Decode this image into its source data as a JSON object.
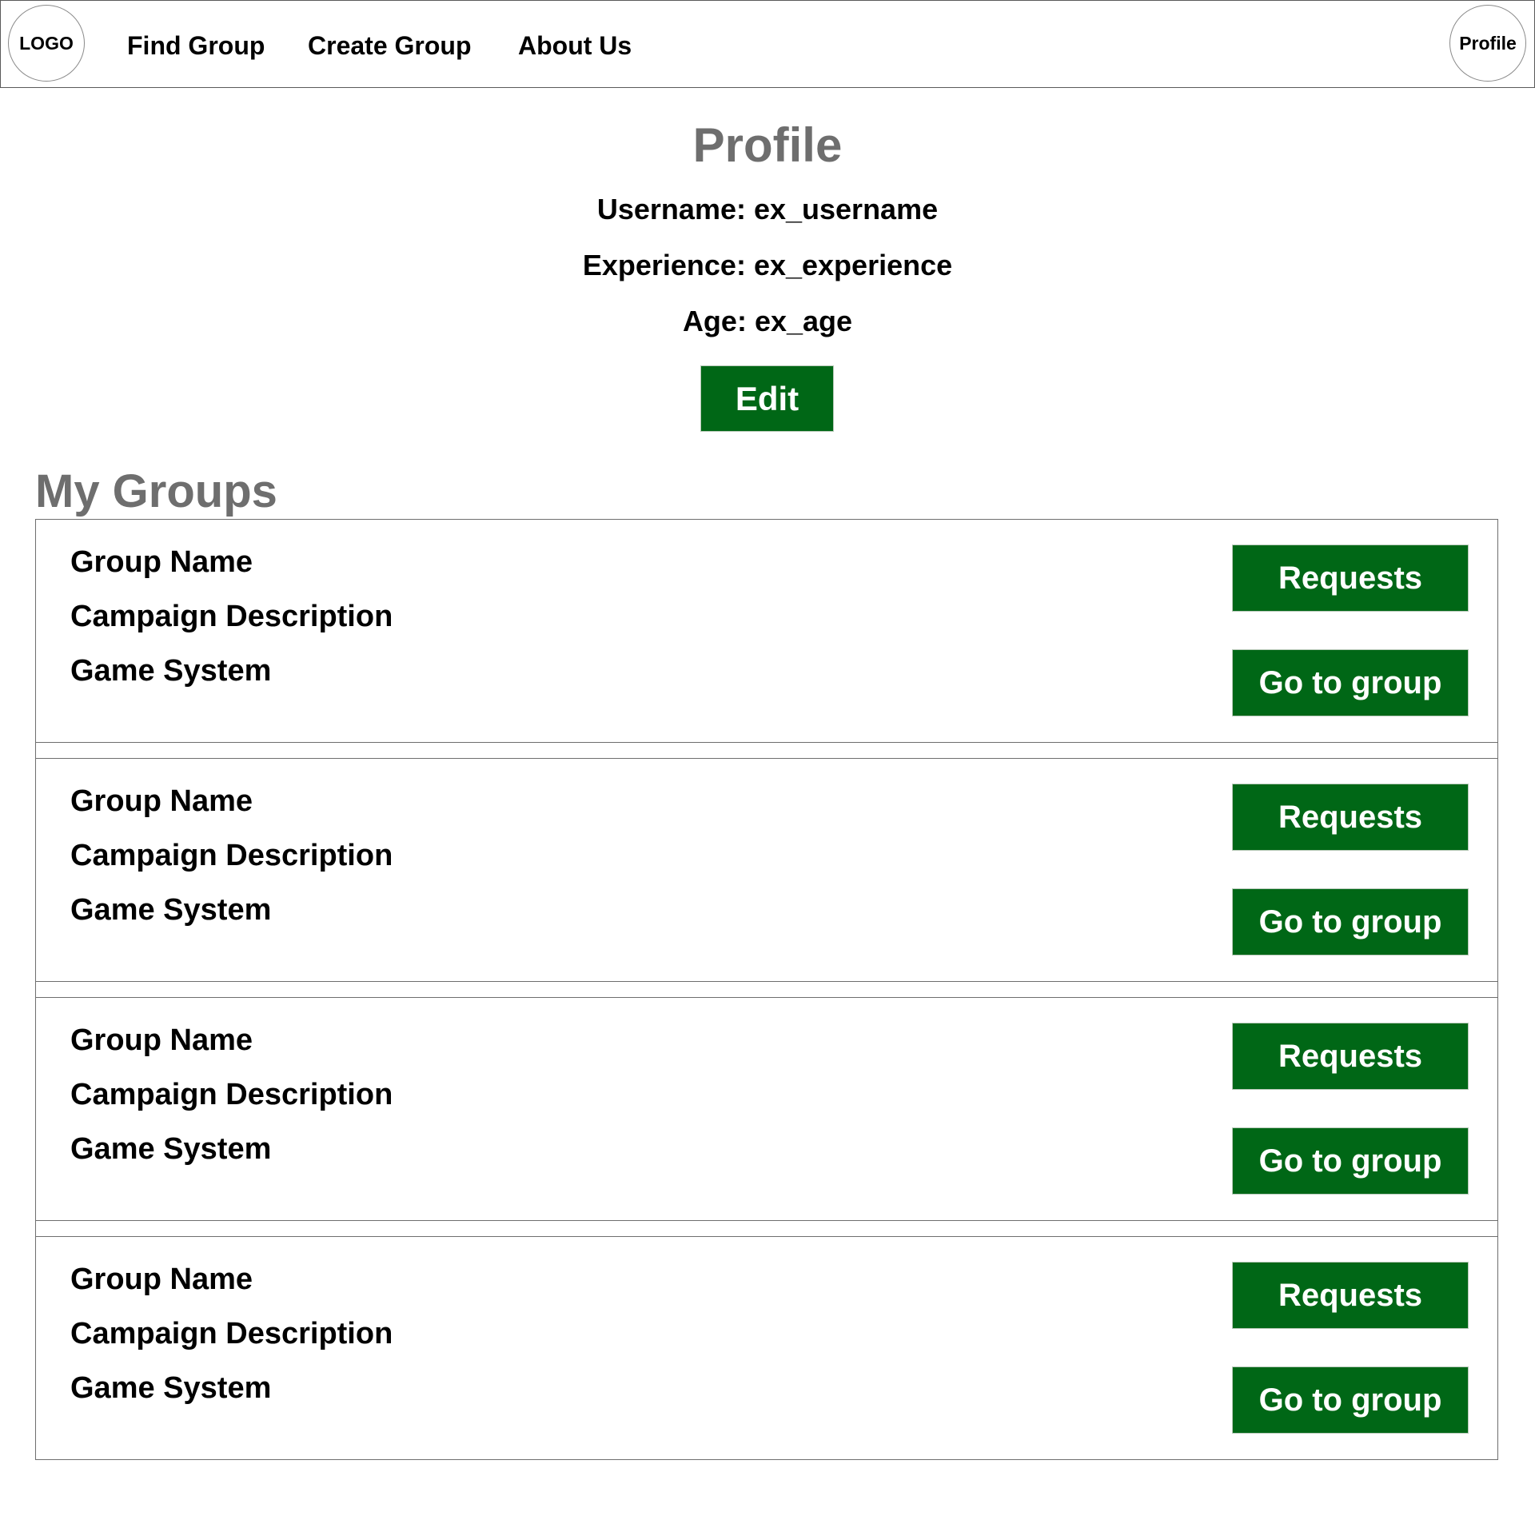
{
  "nav": {
    "logo_label": "LOGO",
    "links": [
      "Find Group",
      "Create Group",
      "About Us"
    ],
    "profile_label": "Profile"
  },
  "profile": {
    "title": "Profile",
    "username": "Username: ex_username",
    "experience": "Experience: ex_experience",
    "age": "Age: ex_age",
    "edit_label": "Edit"
  },
  "groups": {
    "title": "My Groups",
    "items": [
      {
        "name": "Group Name",
        "description": "Campaign Description",
        "system": "Game System",
        "requests_label": "Requests",
        "goto_label": "Go to group"
      },
      {
        "name": "Group Name",
        "description": "Campaign Description",
        "system": "Game System",
        "requests_label": "Requests",
        "goto_label": "Go to group"
      },
      {
        "name": "Group Name",
        "description": "Campaign Description",
        "system": "Game System",
        "requests_label": "Requests",
        "goto_label": "Go to group"
      },
      {
        "name": "Group Name",
        "description": "Campaign Description",
        "system": "Game System",
        "requests_label": "Requests",
        "goto_label": "Go to group"
      }
    ]
  },
  "colors": {
    "button_green": "#006716",
    "heading_gray": "#6e6e6e"
  }
}
